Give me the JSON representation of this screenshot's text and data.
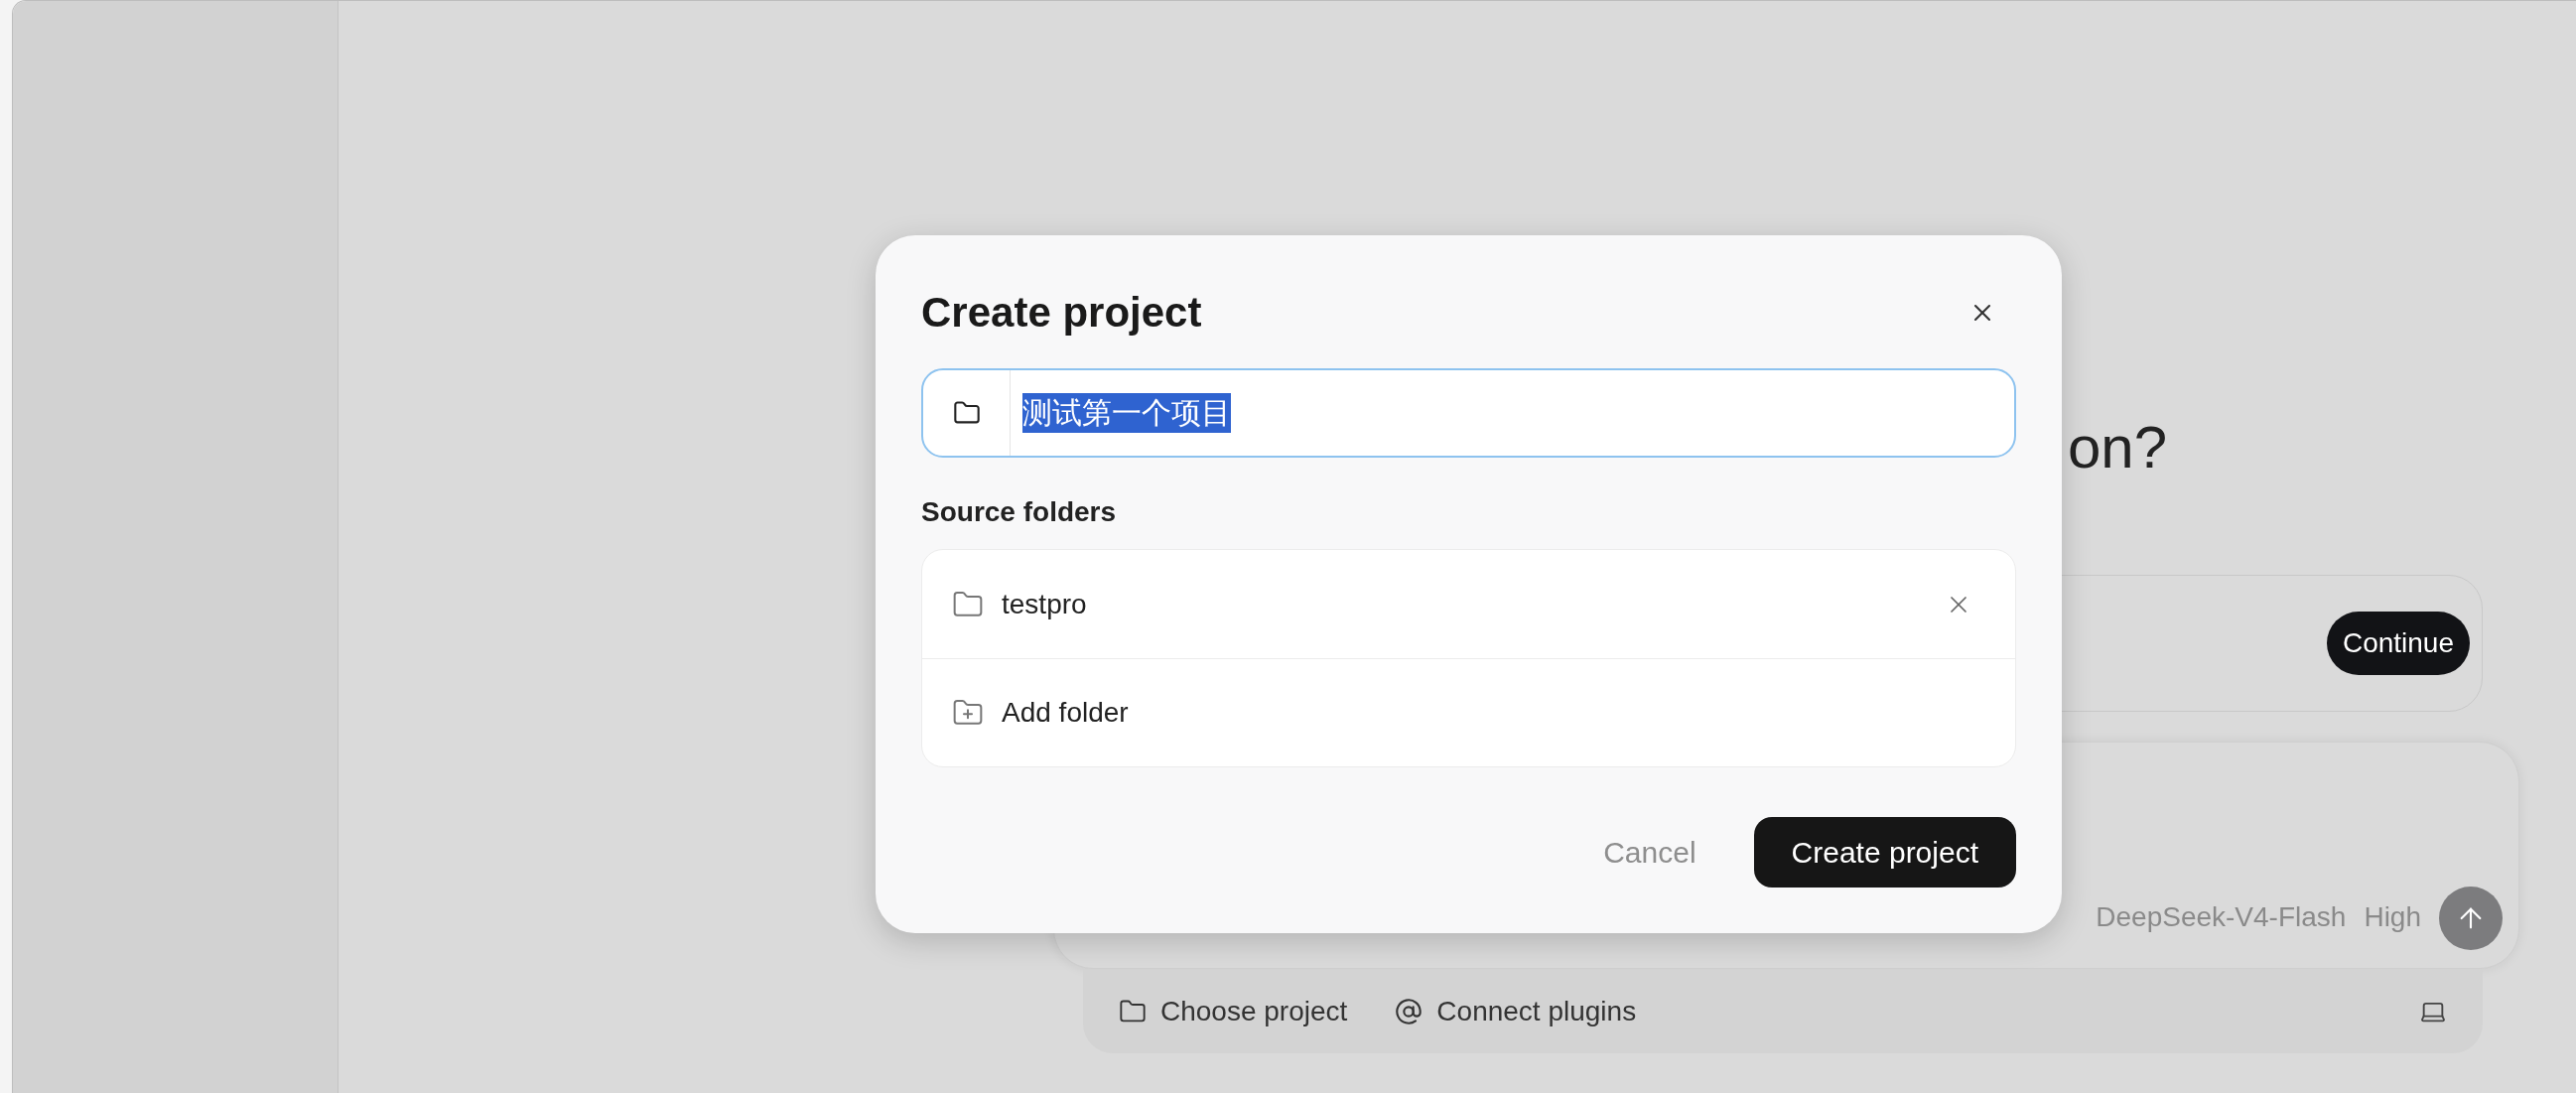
{
  "background": {
    "heading": "on?",
    "continue_button": "Continue",
    "composer": {
      "model": "DeepSeek-V4-Flash",
      "effort": "High"
    },
    "bottom_bar": [
      {
        "kind": "project",
        "label": "Choose project"
      },
      {
        "kind": "plugins",
        "label": "Connect plugins"
      }
    ]
  },
  "dialog": {
    "title": "Create project",
    "name_field": {
      "value": "测试第一个项目",
      "selected": true
    },
    "section_title": "Source folders",
    "folders": [
      {
        "kind": "folder",
        "label": "testpro"
      },
      {
        "kind": "add",
        "label": "Add folder"
      }
    ],
    "buttons": [
      {
        "kind": "secondary",
        "label": "Cancel"
      },
      {
        "kind": "primary",
        "label": "Create project"
      }
    ]
  }
}
